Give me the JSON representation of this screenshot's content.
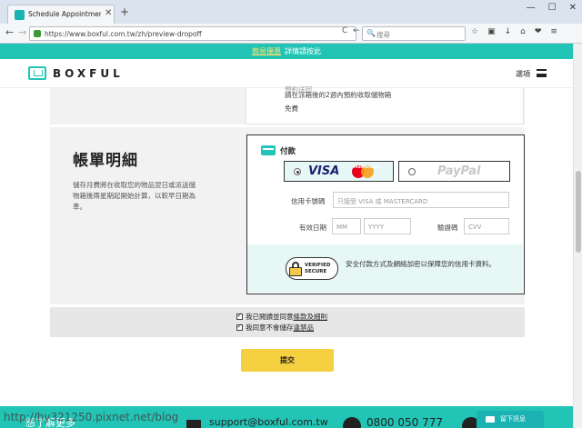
{
  "browser": {
    "tab_title": "Schedule Appointment |...",
    "close_glyph": "✕",
    "new_tab_glyph": "+",
    "window_controls": [
      "—",
      "☐",
      "✕"
    ],
    "back_glyph": "←",
    "forward_glyph": "→",
    "info_glyph": "ⓘ",
    "url": "https://www.boxful.com.tw/zh/preview-dropoff",
    "reload_glyph": "C",
    "back_small_glyph": "←",
    "search_placeholder": "搜尋",
    "search_glyph": "🔍",
    "toolbar": [
      "☆",
      "▣",
      "↓",
      "⌂",
      "❤",
      "≡"
    ]
  },
  "promo": {
    "link": "簡易優惠",
    "text": "詳情請按此"
  },
  "header": {
    "logo": "BOXFUL",
    "menu_label": "選項"
  },
  "previous": {
    "line1": "預約送回",
    "line2": "請在派箱後的2週內預約收取儲物箱",
    "line3": "免費"
  },
  "billing": {
    "title": "帳單明細",
    "description": "儲存月費將在收取您的物品翌日或派送儲物箱後兩星期起開始計算，以較早日期為準。"
  },
  "payment": {
    "label": "付款",
    "visa": "VISA",
    "mastercard": "MasterCard",
    "paypal": "PayPal",
    "card_number_label": "信用卡號碼",
    "card_number_placeholder": "只接受 VISA 或 MASTERCARD",
    "expiry_label": "有效日期",
    "month_placeholder": "MM",
    "year_placeholder": "YYYY",
    "cvv_label": "驗證碼",
    "cvv_placeholder": "CVV",
    "verified_line1": "VERIFIED",
    "verified_line2": "SECURE",
    "secure_text": "安全付款方式及網絡加密以保障您的信用卡資料。"
  },
  "terms": {
    "agree_prefix": "我已閱讀並同意",
    "agree_link": "條款及細則",
    "no_store_prefix": "我同意不會儲存",
    "no_store_link": "違禁品"
  },
  "submit_label": "提交",
  "footer": {
    "text": "想了解更多",
    "email": "support@boxful.com.tw",
    "phone": "0800 050 777"
  },
  "message_button": "留下訊息",
  "watermark": "http://hy321250.pixnet.net/blog"
}
